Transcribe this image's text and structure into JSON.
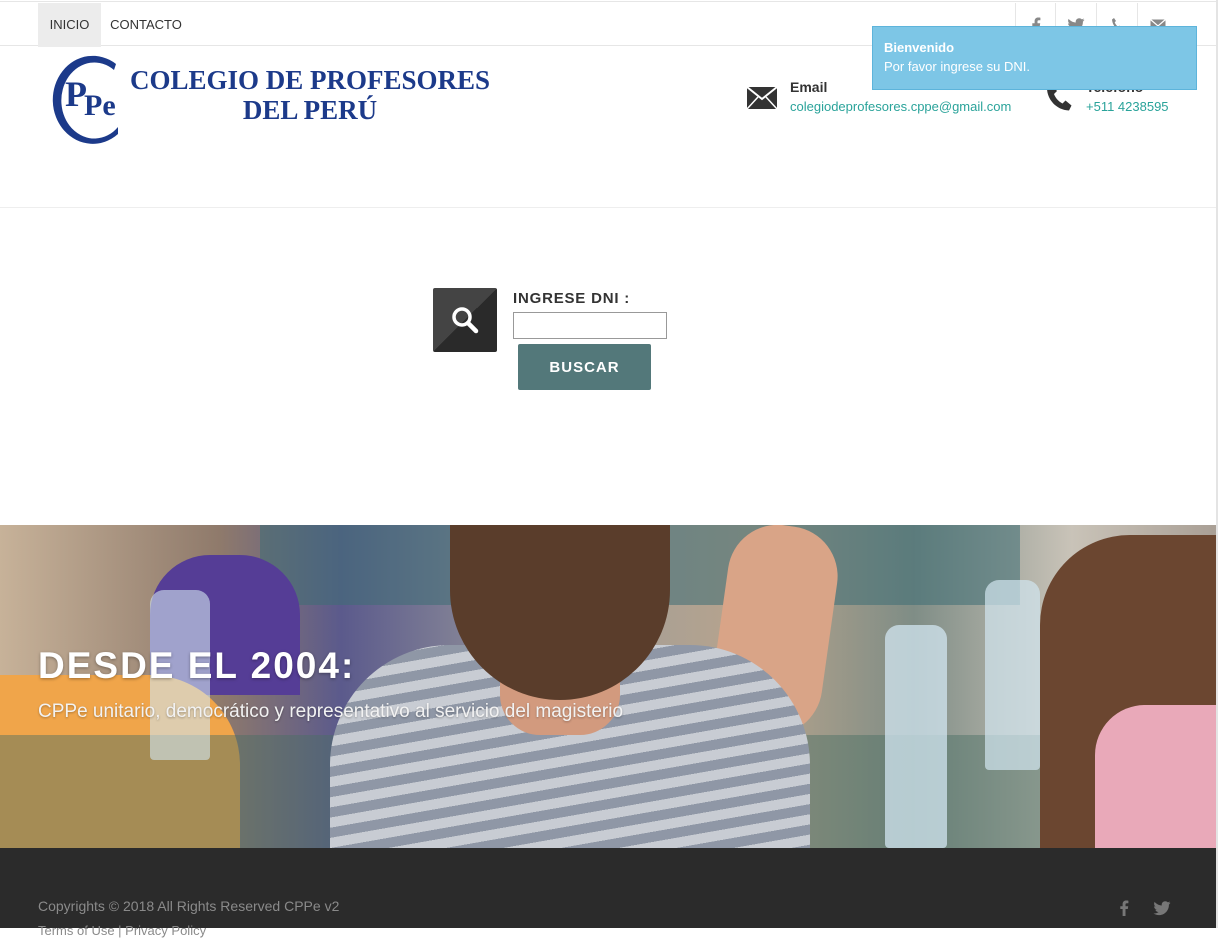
{
  "nav": {
    "items": [
      {
        "label": "INICIO",
        "active": true
      },
      {
        "label": "CONTACTO",
        "active": false
      }
    ],
    "social": [
      "facebook-icon",
      "twitter-icon",
      "phone-icon",
      "mail-icon"
    ]
  },
  "logo": {
    "monogram": "CPPe",
    "line1": "COLEGIO DE PROFESORES",
    "line2": "DEL PERÚ"
  },
  "contact": {
    "email_label": "Email",
    "email_value": "colegiodeprofesores.cppe@gmail.com",
    "phone_label": "Teléfono",
    "phone_value": "+511 4238595"
  },
  "search": {
    "label": "INGRESE DNI :",
    "input_value": "",
    "button_label": "BUSCAR"
  },
  "hero": {
    "title": "DESDE EL 2004:",
    "subtitle": "CPPe unitario, democrático y representativo al servicio del magisterio"
  },
  "footer": {
    "copyright": "Copyrights © 2018 All Rights Reserved CPPe v2",
    "links": "Terms of Use | Privacy Policy"
  },
  "toast": {
    "title": "Bienvenido",
    "message": "Por favor ingrese su DNI."
  },
  "colors": {
    "accent": "#2aa39a",
    "button": "#53787a",
    "toast": "#7dc6e6",
    "footer": "#2b2b2b",
    "logo": "#1c3a8a"
  }
}
